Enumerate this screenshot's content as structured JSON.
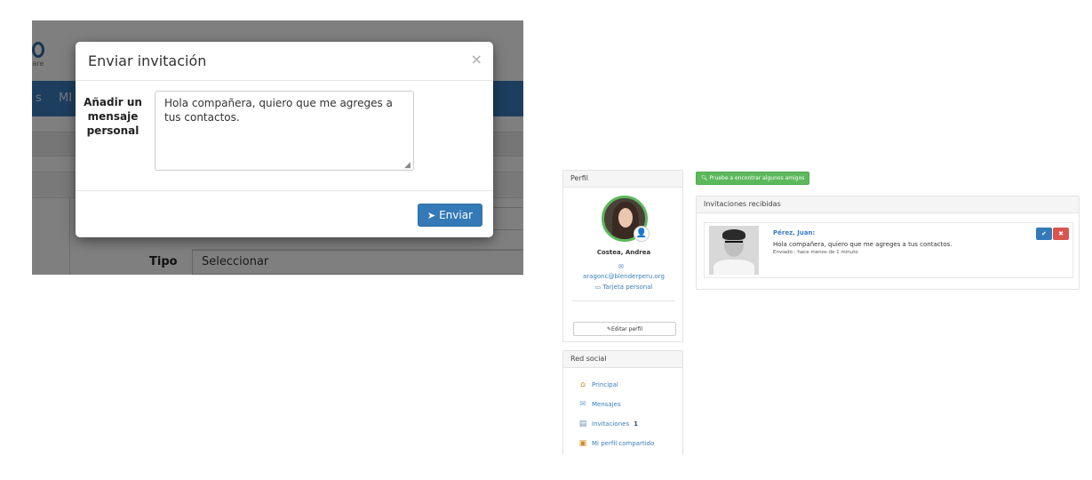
{
  "left_screenshot": {
    "background": {
      "logo_sub": "ware",
      "nav_items": [
        "s",
        "MI"
      ],
      "tipo_label": "Tipo",
      "tipo_value": "Seleccionar"
    },
    "modal": {
      "title": "Enviar invitación",
      "close_symbol": "×",
      "message_label": "Añadir un mensaje personal",
      "message_value": "Hola compañera, quiero que me agreges a tus contactos.",
      "send_label": "Enviar"
    }
  },
  "right_screenshot": {
    "profile": {
      "heading": "Perfil",
      "name": "Costea, Andrea",
      "email": "aragonc@blenderperu.org",
      "card_link": "Tarjeta personal",
      "edit_button": "Editar perfil"
    },
    "social": {
      "heading": "Red social",
      "items": [
        {
          "label": "Principal",
          "icon": "home-icon"
        },
        {
          "label": "Mensajes",
          "icon": "envelope-icon"
        },
        {
          "label": "Invitaciones",
          "icon": "invitation-icon",
          "count": "1"
        },
        {
          "label": "Mi perfil compartido",
          "icon": "shared-profile-icon"
        }
      ]
    },
    "find_friends_button": "Pruebe a encontrar algunos amigos",
    "invitations": {
      "heading": "Invitaciones recibidas",
      "items": [
        {
          "sender": "Pérez, Juan:",
          "message": "Hola compañera, quiero que me agreges a tus contactos.",
          "sent": "Enviado : hace menos de 1 minuto"
        }
      ]
    }
  },
  "colors": {
    "primary": "#337ab7",
    "success": "#5cb85c",
    "danger": "#d9534f",
    "nav": "#3a7dbf"
  }
}
